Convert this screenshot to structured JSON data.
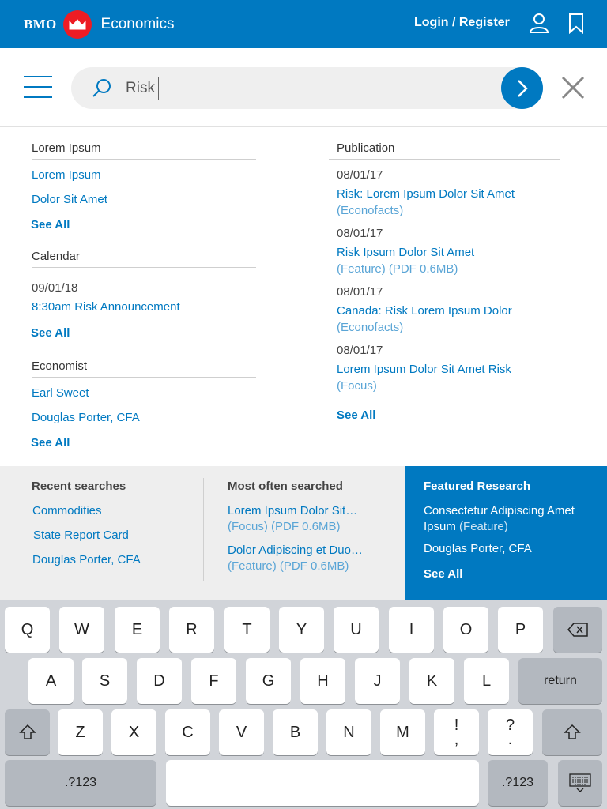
{
  "header": {
    "brand": "BMO",
    "app_title": "Economics",
    "login_label": "Login / Register",
    "colors": {
      "brand_blue": "#0079c1",
      "brand_red": "#ed1c24"
    }
  },
  "search": {
    "value": "Risk"
  },
  "left": {
    "lorem_section": {
      "heading": "Lorem Ipsum",
      "items": [
        "Lorem Ipsum",
        "Dolor Sit Amet"
      ],
      "see_all": "See All"
    },
    "calendar_section": {
      "heading": "Calendar",
      "date": "09/01/18",
      "event": "8:30am Risk Announcement",
      "see_all": "See All"
    },
    "economist_section": {
      "heading": "Economist",
      "items": [
        "Earl Sweet",
        "Douglas Porter, CFA"
      ],
      "see_all": "See All"
    }
  },
  "publication": {
    "heading": "Publication",
    "items": [
      {
        "date": "08/01/17",
        "title": "Risk: Lorem Ipsum Dolor Sit Amet",
        "type": "(Econofacts)"
      },
      {
        "date": "08/01/17",
        "title": "Risk Ipsum Dolor Sit Amet",
        "type": "(Feature) (PDF 0.6MB)"
      },
      {
        "date": "08/01/17",
        "title": "Canada: Risk Lorem Ipsum Dolor",
        "type": "(Econofacts)"
      },
      {
        "date": "08/01/17",
        "title": "Lorem Ipsum Dolor Sit Amet Risk",
        "type": "(Focus)"
      }
    ],
    "see_all": "See All"
  },
  "recent": {
    "heading": "Recent searches",
    "items": [
      "Commodities",
      "State Report Card",
      "Douglas Porter, CFA"
    ]
  },
  "most_often": {
    "heading": "Most often searched",
    "items": [
      {
        "title": "Lorem Ipsum Dolor Sit…",
        "type": "(Focus) (PDF 0.6MB)"
      },
      {
        "title": "Dolor Adipiscing et Duo…",
        "type": "(Feature) (PDF 0.6MB)"
      }
    ]
  },
  "featured": {
    "heading": "Featured Research",
    "title_line1": "Consectetur Adipiscing Amet",
    "title_line2": "Ipsum",
    "type": "(Feature)",
    "author": "Douglas Porter, CFA",
    "see_all": "See All"
  },
  "keyboard": {
    "row1": [
      "Q",
      "W",
      "E",
      "R",
      "T",
      "Y",
      "U",
      "I",
      "O",
      "P"
    ],
    "row2": [
      "A",
      "S",
      "D",
      "F",
      "G",
      "H",
      "J",
      "K",
      "L"
    ],
    "return_label": "return",
    "row3": [
      "Z",
      "X",
      "C",
      "V",
      "B",
      "N",
      "M"
    ],
    "punct1_top": "!",
    "punct1_bottom": ",",
    "punct2_top": "?",
    "punct2_bottom": ".",
    "numbers_label": ".?123"
  }
}
